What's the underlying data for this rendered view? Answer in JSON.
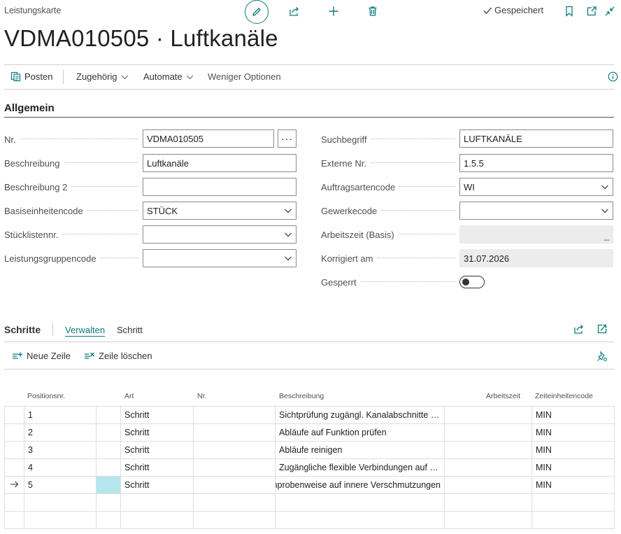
{
  "header": {
    "page_type": "Leistungskarte",
    "saved_label": "Gespeichert",
    "title": "VDMA010505 · Luftkanäle"
  },
  "actionbar": {
    "items": [
      {
        "label": "Posten",
        "icon": "ledger-icon"
      },
      {
        "label": "Zugehörig",
        "icon": "chevron-down-icon"
      },
      {
        "label": "Automate",
        "icon": "chevron-down-icon"
      },
      {
        "label": "Weniger Optionen"
      }
    ]
  },
  "general": {
    "section_title": "Allgemein",
    "left": [
      {
        "label": "Nr.",
        "value": "VDMA010505",
        "kind": "assist"
      },
      {
        "label": "Beschreibung",
        "value": "Luftkanäle",
        "kind": "text"
      },
      {
        "label": "Beschreibung 2",
        "value": "",
        "kind": "text"
      },
      {
        "label": "Basiseinheitencode",
        "value": "STÜCK",
        "kind": "select"
      },
      {
        "label": "Stücklistennr.",
        "value": "",
        "kind": "select"
      },
      {
        "label": "Leistungsgruppencode",
        "value": "",
        "kind": "select"
      }
    ],
    "right": [
      {
        "label": "Suchbegriff",
        "value": "LUFTKANÄLE",
        "kind": "text"
      },
      {
        "label": "Externe Nr.",
        "value": "1.5.5",
        "kind": "text"
      },
      {
        "label": "Auftragsartencode",
        "value": "WI",
        "kind": "select"
      },
      {
        "label": "Gewerkecode",
        "value": "",
        "kind": "select"
      },
      {
        "label": "Arbeitszeit (Basis)",
        "value": "_",
        "kind": "readonly"
      },
      {
        "label": "Korrigiert am",
        "value": "31.07.2026",
        "kind": "readonly"
      },
      {
        "label": "Gesperrt",
        "value": "off",
        "kind": "toggle"
      }
    ]
  },
  "steps": {
    "title": "Schritte",
    "tabs": [
      "Verwalten",
      "Schritt"
    ],
    "actions": [
      {
        "label": "Neue Zeile",
        "icon": "new-line-icon"
      },
      {
        "label": "Zeile löschen",
        "icon": "delete-line-icon"
      }
    ],
    "columns": [
      "Positionsnr.",
      "Art",
      "Nr.",
      "Beschreibung",
      "Arbeitszeit",
      "Zeiteinheitencode"
    ],
    "rows": [
      {
        "pos": "1",
        "art": "Schritt",
        "nr": "",
        "desc": "Sichtprüfung zugängl. Kanalabschnitte e…",
        "time": "",
        "unit": "MIN"
      },
      {
        "pos": "2",
        "art": "Schritt",
        "nr": "",
        "desc": "Abläufe auf Funktion prüfen",
        "time": "",
        "unit": "MIN"
      },
      {
        "pos": "3",
        "art": "Schritt",
        "nr": "",
        "desc": "Abläufe reinigen",
        "time": "",
        "unit": "MIN"
      },
      {
        "pos": "4",
        "art": "Schritt",
        "nr": "",
        "desc": "Zugängliche flexible Verbindungen auf …",
        "time": "",
        "unit": "MIN"
      },
      {
        "pos": "5",
        "art": "Schritt",
        "nr": "",
        "desc": "nprobenweise auf innere Verschmutzungen",
        "time": "",
        "unit": "MIN"
      }
    ]
  },
  "colors": {
    "accent": "#0f7b7b",
    "selection": "#b4e6ec"
  }
}
